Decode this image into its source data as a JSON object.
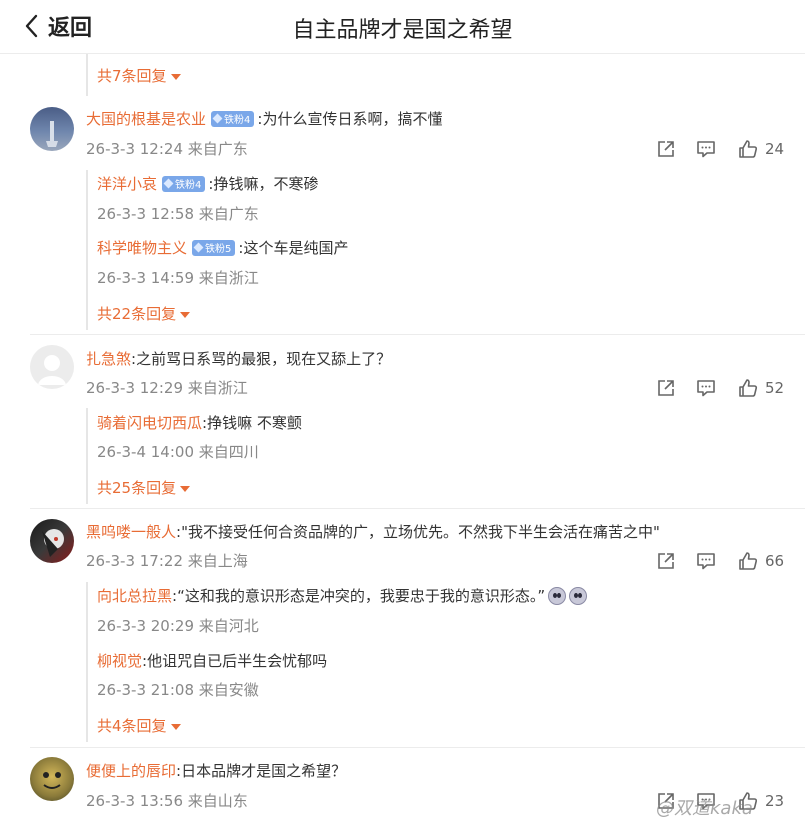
{
  "header": {
    "back_label": "返回",
    "title": "自主品牌才是国之希望"
  },
  "colors": {
    "accent": "#e86c35",
    "meta": "#888888",
    "badge": "#7aa7e9"
  },
  "top_more": "共7条回复",
  "comments": [
    {
      "username": "大国的根基是农业",
      "badge": "铁粉4",
      "text": ":为什么宣传日系啊，搞不懂",
      "meta": "26-3-3 12:24 来自广东",
      "likes": "24",
      "replies": [
        {
          "username": "洋洋小哀",
          "badge": "铁粉4",
          "text": ":挣钱嘛，不寒碜",
          "meta": "26-3-3 12:58 来自广东"
        },
        {
          "username": "科学唯物主义",
          "badge": "铁粉5",
          "text": ":这个车是纯国产",
          "meta": "26-3-3 14:59 来自浙江"
        }
      ],
      "more": "共22条回复"
    },
    {
      "username": "扎急煞",
      "text": ":之前骂日系骂的最狠，现在又舔上了？",
      "meta": "26-3-3 12:29 来自浙江",
      "likes": "52",
      "replies": [
        {
          "username": "骑着闪电切西瓜",
          "text": ":挣钱嘛 不寒颤",
          "meta": "26-3-4 14:00 来自四川"
        }
      ],
      "more": "共25条回复"
    },
    {
      "username": "黑呜喽一般人",
      "text": ":\"我不接受任何合资品牌的广，立场优先。不然我下半生会活在痛苦之中\"",
      "meta": "26-3-3 17:22 来自上海",
      "likes": "66",
      "replies": [
        {
          "username": "向北总拉黑",
          "text": ":“这和我的意识形态是冲突的，我要忠于我的意识形态。”",
          "meta": "26-3-3 20:29 来自河北"
        },
        {
          "username": "柳视觉",
          "text": ":他诅咒自已后半生会忧郁吗",
          "meta": "26-3-3 21:08 来自安徽"
        }
      ],
      "more": "共4条回复"
    },
    {
      "username": "便便上的唇印",
      "text": ":日本品牌才是国之希望？",
      "meta": "26-3-3 13:56 来自山东",
      "likes": "23"
    }
  ],
  "watermark": "@双道kaka",
  "icons": [
    "chevron-left-icon",
    "share-icon",
    "comment-icon",
    "like-icon",
    "caret-down-icon",
    "diamond-icon",
    "shocked-emoji-icon"
  ]
}
